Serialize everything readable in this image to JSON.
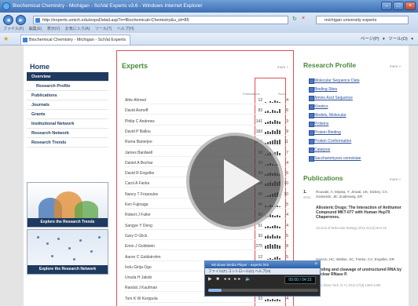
{
  "browser": {
    "window_title": "Biochemical Chemistry - Michigan - SciVal Experts v3.6 - Windows Internet Explorer",
    "url": "http://experts.umich.edu/expsDetail.asp?n=Biochemical+Chemistry&u_id=85",
    "search_value": "michigan university experts",
    "menu_text": "ファイル(F) 編集(E) 表示(V) お気に入り(A) ツール(T) ヘルプ(H)",
    "tab_title": "Biochemical Chemistry - Michigan - SciVal Experts ...",
    "toolbar_text": "ページ(P) ▾ ツール(O) ▾"
  },
  "left": {
    "home": "Home",
    "nav": [
      "Overview",
      "Research Profile",
      "Publications",
      "Journals",
      "Grants",
      "Institutional Network",
      "Research Network",
      "Research Trends"
    ],
    "thumb1_caption": "Explore the Research Trends",
    "thumb2_caption": "Explore the Research Network"
  },
  "experts": {
    "title": "Experts",
    "more": "more »",
    "col_pubs": "Publications",
    "col_score": "Score",
    "rows": [
      {
        "name": "Ahle Ahmed",
        "count": "12",
        "score": "4",
        "bars": [
          1,
          0,
          2,
          1,
          3,
          2,
          1
        ]
      },
      {
        "name": "David Asmoff",
        "count": "83",
        "score": "6",
        "bars": [
          2,
          3,
          1,
          4,
          3,
          2,
          5
        ]
      },
      {
        "name": "Philip C Andrews",
        "count": "141",
        "score": "3",
        "bars": [
          2,
          3,
          4,
          3,
          5,
          4,
          3
        ]
      },
      {
        "name": "David P Ballou",
        "count": "183",
        "score": "9",
        "bars": [
          3,
          4,
          3,
          5,
          4,
          6,
          5
        ]
      },
      {
        "name": "Ruma Banerjee",
        "count": "246",
        "score": "11",
        "bars": [
          2,
          3,
          4,
          5,
          6,
          5,
          6
        ]
      },
      {
        "name": "James Bardwell",
        "count": "98",
        "score": "7",
        "bars": [
          1,
          2,
          4,
          3,
          4,
          5,
          3
        ]
      },
      {
        "name": "Daniel A Bochar",
        "count": "29",
        "score": "4",
        "bars": [
          1,
          2,
          3,
          2,
          1,
          2,
          1
        ]
      },
      {
        "name": "David R Engelke",
        "count": "84",
        "score": "6",
        "bars": [
          2,
          3,
          4,
          3,
          4,
          3,
          2
        ]
      },
      {
        "name": "Carol A Fierke",
        "count": "168",
        "score": "10",
        "bars": [
          3,
          4,
          5,
          4,
          6,
          5,
          6
        ]
      },
      {
        "name": "Nancy T Fropoulos",
        "count": "68",
        "score": "10",
        "bars": [
          1,
          2,
          3,
          4,
          5,
          6,
          4
        ]
      },
      {
        "name": "Ken Fujinaga",
        "count": "46",
        "score": "5",
        "bars": [
          2,
          1,
          3,
          2,
          3,
          2,
          1
        ]
      },
      {
        "name": "Robert J Fuller",
        "count": "80",
        "score": "4",
        "bars": [
          3,
          2,
          4,
          3,
          2,
          3,
          2
        ]
      },
      {
        "name": "Sangye Y Deng",
        "count": "51",
        "score": "4",
        "bars": [
          2,
          3,
          2,
          3,
          4,
          3,
          2
        ]
      },
      {
        "name": "Gary D Glick",
        "count": "93",
        "score": "5",
        "bars": [
          3,
          4,
          3,
          5,
          3,
          4,
          3
        ]
      },
      {
        "name": "Erion J Goldstein",
        "count": "275",
        "score": "8",
        "bars": [
          4,
          5,
          6,
          5,
          6,
          5,
          4
        ]
      },
      {
        "name": "Aaron C Goldstrohm",
        "count": "12",
        "score": "5",
        "bars": [
          0,
          1,
          2,
          1,
          3,
          4,
          2
        ]
      },
      {
        "name": "Indu Girija Ogo",
        "count": "38",
        "score": "4",
        "bars": [
          1,
          2,
          3,
          2,
          3,
          2,
          3
        ]
      },
      {
        "name": "Ursula H Jakob",
        "count": "76",
        "score": "6",
        "bars": [
          2,
          3,
          4,
          3,
          5,
          4,
          3
        ]
      },
      {
        "name": "Randal J Kaufman",
        "count": "212",
        "score": "4",
        "bars": [
          4,
          5,
          4,
          6,
          5,
          4,
          5
        ]
      },
      {
        "name": "Tom K W Kerppola",
        "count": "53",
        "score": "4",
        "bars": [
          2,
          3,
          2,
          3,
          2,
          3,
          2
        ]
      }
    ]
  },
  "research_profile": {
    "title": "Research Profile",
    "more": "more »",
    "items": [
      "Molecular Sequence Data",
      "Binding Sites",
      "Amino Acid Sequence",
      "Kinetics",
      "Models, Molecular",
      "Proteins",
      "Protein Binding",
      "Protein Conformation",
      "Catalysis",
      "Saccharomyces cerevisiae"
    ]
  },
  "publications": {
    "title": "Publications",
    "more": "more »",
    "items": [
      {
        "num": "1.",
        "year": "2011",
        "authors": "Rousaki, A; Miyata, Y; Jinwal, UK; Dickey, CA; Gestwicki, JE; Zuiderweg, ER",
        "title": "Allosteric Drugs: The Interaction of Antitumor Compound MKT-077 with Human Hsp70 Chaperones.",
        "source": "Journal of Molecular Biology 2011;411(3):614-32"
      },
      {
        "num": "",
        "year": "",
        "authors": "Harvon, HC; Walker, SC; Fierke, CA; Engelke, DR",
        "title": "Binding and cleavage of unstructured RNA by nuclear RNase P.",
        "source": "RNA (New York, N.Y.) 2011;17(8):1393-1400"
      }
    ]
  },
  "media_player": {
    "title": "Windows Media Player - experts.htm",
    "menu": "ファイル(F)  コントロール(C)  ヘルプ(H)",
    "time": "00:00 / 04:15",
    "progress": 0.12
  }
}
